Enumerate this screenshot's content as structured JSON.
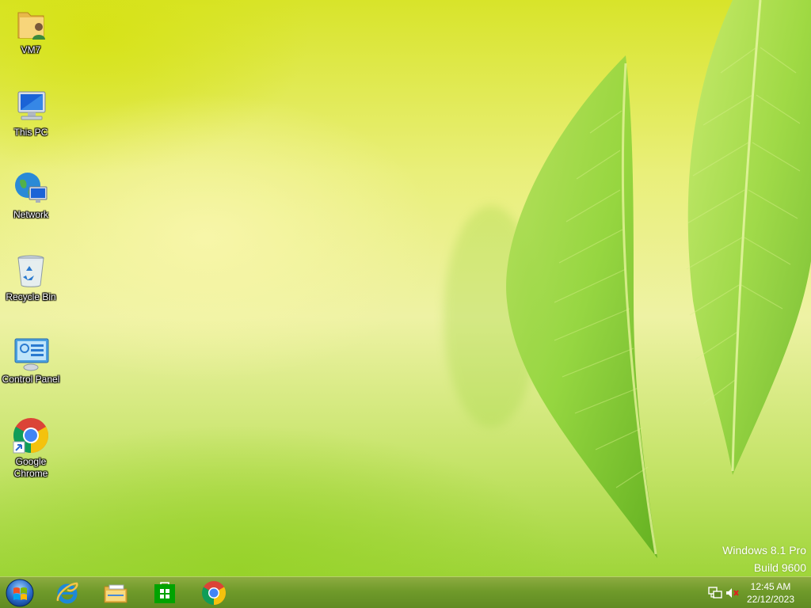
{
  "desktop": {
    "icons": [
      {
        "label": "VM7",
        "icon": "user-folder-icon"
      },
      {
        "label": "This PC",
        "icon": "computer-icon"
      },
      {
        "label": "Network",
        "icon": "network-icon"
      },
      {
        "label": "Recycle Bin",
        "icon": "recycle-bin-icon"
      },
      {
        "label": "Control Panel",
        "icon": "control-panel-icon"
      },
      {
        "label": "Google\nChrome",
        "icon": "chrome-icon"
      }
    ],
    "watermark": {
      "line1": "Windows 8.1 Pro",
      "line2": "Build 9600"
    }
  },
  "taskbar": {
    "pinned": [
      {
        "icon": "start-orb-icon"
      },
      {
        "icon": "internet-explorer-icon"
      },
      {
        "icon": "file-explorer-icon"
      },
      {
        "icon": "store-icon"
      },
      {
        "icon": "chrome-icon"
      }
    ],
    "tray": {
      "icons": [
        "network-tray-icon",
        "volume-muted-icon"
      ],
      "time": "12:45 AM",
      "date": "22/12/2023"
    }
  },
  "colors": {
    "taskbar": "#6f9a2a",
    "leaf": "#8fd43a",
    "wallpaper_light": "#eef2a4"
  }
}
